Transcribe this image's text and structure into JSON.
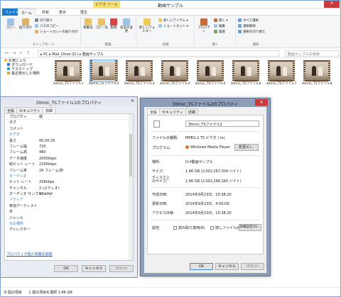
{
  "window": {
    "title": "動画サンプル",
    "context_tab": "ビデオ ツール",
    "close": "✕"
  },
  "ribbon_tabs": [
    "ファイル",
    "ホーム",
    "共有",
    "表示",
    "再生"
  ],
  "ribbon": {
    "copy": "コピー",
    "paste": "貼り付け",
    "cut": "切り取り",
    "copy_path": "パスのコピー",
    "paste_shortcut": "ショートカットの貼り付け",
    "move_to": "移動先",
    "copy_to": "コピー先",
    "delete": "削除",
    "rename": "名前の変更",
    "new_folder": "新しいフォルダー",
    "new_item": "新しいアイテム ▾",
    "shortcut": "ショートカット ▾",
    "properties": "プロパティ",
    "open": "開く ▾",
    "edit": "編集",
    "history": "履歴",
    "select_all": "すべて選択",
    "select_none": "選択解除",
    "invert": "選択の切り替え",
    "groups": [
      "クリップボード",
      "整理",
      "新規",
      "開く",
      "選択"
    ]
  },
  "address": {
    "path": "▸ PC ▸ Mail_Drive (D:) ▸ 動画サンプル",
    "search_placeholder": "動画サンプルの検索"
  },
  "nav": [
    "お気に入り",
    "ダウンロード",
    "デスクトップ",
    "最近表示した場所"
  ],
  "files": [
    "30min_TSファイル1",
    "30min_TSファイル2",
    "30min_TSファイル3",
    "30min_TSファイル4",
    "30min_TSファイル5",
    "30min_TSファイル6",
    "30min_TSファイル7",
    "30min_TSファイル8"
  ],
  "status": {
    "count": "8 個の項目",
    "selected": "1 個の項目を選択 1.86 GB"
  },
  "dialog1": {
    "title": "30min_TSファイル1のプロパティ",
    "tabs": [
      "全般",
      "セキュリティ",
      "詳細"
    ],
    "header": [
      "プロパティ",
      "値"
    ],
    "rows": [
      {
        "k": "タグ",
        "v": ""
      },
      {
        "k": "コメント",
        "v": ""
      },
      {
        "k": "ビデオ",
        "v": "",
        "h": true
      },
      {
        "k": "長さ",
        "v": "00:30:25"
      },
      {
        "k": "フレーム幅",
        "v": "720"
      },
      {
        "k": "フレーム高",
        "v": "480"
      },
      {
        "k": "データ速度",
        "v": "2000kbps"
      },
      {
        "k": "総ビット レート",
        "v": "2256kbps"
      },
      {
        "k": "フレーム率",
        "v": "29 フレーム/秒"
      },
      {
        "k": "オーディオ",
        "v": "",
        "h": true
      },
      {
        "k": "ビット レート",
        "v": "256kbps"
      },
      {
        "k": "チャンネル",
        "v": "2 (ステレオ)"
      },
      {
        "k": "オーディオ サンプル レート",
        "v": "48 kHz"
      },
      {
        "k": "メディア",
        "v": "",
        "h": true
      },
      {
        "k": "参加アーティスト",
        "v": ""
      },
      {
        "k": "年",
        "v": ""
      },
      {
        "k": "ジャンル",
        "v": ""
      },
      {
        "k": "元の場所",
        "v": "",
        "h": true
      },
      {
        "k": "ディレクター",
        "v": ""
      }
    ],
    "link": "プロパティや個人情報を削除",
    "ok": "OK",
    "cancel": "キャンセル",
    "apply": "適用(A)"
  },
  "dialog2": {
    "title": "30min_TSファイル2のプロパティ",
    "tabs": [
      "全般",
      "セキュリティ",
      "詳細"
    ],
    "name": "30min_TSファイル2",
    "labels": {
      "type": "ファイルの種類:",
      "program": "プログラム:",
      "location": "場所:",
      "size": "サイズ:",
      "disk": "ディスク上\nのサイズ:",
      "created": "作成日時:",
      "modified": "更新日時:",
      "accessed": "アクセス日時:",
      "attr": "属性:"
    },
    "values": {
      "type": "MPEG-2 TS ビデオ (.ts)",
      "program": "Windows Media Player",
      "change": "変更(C)...",
      "location": "D:¥動画サンプル",
      "size": "1.86 GB (2,002,267,304 バイト)",
      "disk": "1.86 GB (2,002,268,160 バイト)",
      "created": "2014年9月23日、10:38:20",
      "modified": "2014年9月23日、4:00:09",
      "accessed": "2014年9月23日、10:38:20",
      "readonly": "読み取り専用(R)",
      "hidden": "隠しファイル(H)",
      "advanced": "詳細設定(D)..."
    },
    "ok": "OK",
    "cancel": "キャンセル",
    "apply": "適用(A)"
  }
}
